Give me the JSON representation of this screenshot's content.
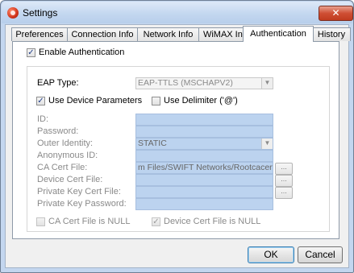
{
  "window": {
    "title": "Settings",
    "close_glyph": "✕",
    "icon": "settings-app-icon"
  },
  "tabs": [
    {
      "label": "Preferences",
      "active": false
    },
    {
      "label": "Connection Info",
      "active": false
    },
    {
      "label": "Network Info",
      "active": false
    },
    {
      "label": "WiMAX Info",
      "active": false
    },
    {
      "label": "Authentication",
      "active": true
    },
    {
      "label": "History",
      "active": false
    }
  ],
  "auth": {
    "enable_label": "Enable Authentication",
    "enable_checked": true,
    "eap_type_label": "EAP Type:",
    "eap_type_value": "EAP-TTLS (MSCHAPV2)",
    "use_device_params_label": "Use Device Parameters",
    "use_device_params_checked": true,
    "use_delimiter_label": "Use Delimiter ('@')",
    "use_delimiter_checked": false,
    "fields": [
      {
        "label": "ID:",
        "value": ""
      },
      {
        "label": "Password:",
        "value": ""
      },
      {
        "label": "Outer Identity:",
        "value": "STATIC"
      },
      {
        "label": "Anonymous ID:",
        "value": ""
      },
      {
        "label": "CA Cert File:",
        "value": "m Files/SWIFT Networks/Rootcacert.pem"
      },
      {
        "label": "Device Cert File:",
        "value": ""
      },
      {
        "label": "Private Key Cert File:",
        "value": ""
      },
      {
        "label": "Private Key Password:",
        "value": ""
      }
    ],
    "browse_label": "...",
    "ca_null_label": "CA Cert File is NULL",
    "ca_null_checked": false,
    "device_null_label": "Device Cert File is NULL",
    "device_null_checked": true
  },
  "buttons": {
    "ok": "OK",
    "cancel": "Cancel"
  },
  "glyphs": {
    "check": "✓",
    "dropdown": "▼"
  }
}
